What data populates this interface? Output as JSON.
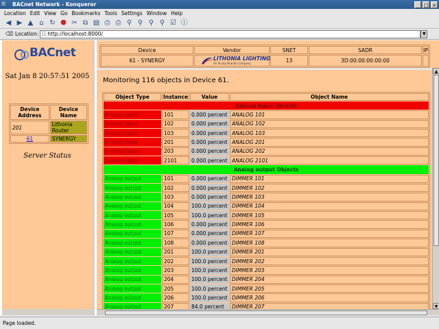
{
  "window": {
    "title": "BACnet Network - Konqueror"
  },
  "menubar": {
    "items": [
      "Location",
      "Edit",
      "View",
      "Go",
      "Bookmarks",
      "Tools",
      "Settings",
      "Window",
      "Help"
    ]
  },
  "toolbar": {
    "icons": [
      "back-icon",
      "forward-icon",
      "up-icon",
      "home-icon",
      "reload-icon",
      "stop-icon",
      "cut-icon",
      "copy-icon",
      "paste-icon",
      "print-icon",
      "print-frame-icon",
      "zoom-in-icon",
      "zoom-out-icon",
      "zoom-in-2-icon",
      "zoom-out-2-icon",
      "lock-icon",
      "info-icon"
    ]
  },
  "location": {
    "label": "Location:",
    "url": "http://localhost:8000/"
  },
  "left": {
    "logo_text": "BACnet",
    "datetime": "Sat Jan 8 20:57:51 2005",
    "device_table": {
      "headers": [
        "Device Address",
        "Device Name"
      ],
      "rows": [
        {
          "address": "201",
          "name": "Lithonia Router"
        },
        {
          "address": "61",
          "name": "SYNERGY"
        }
      ]
    },
    "server_status": "Server Status"
  },
  "header_table": {
    "headers": [
      "Device",
      "Vendor",
      "SNET",
      "SADR",
      "IP"
    ],
    "row": {
      "device": "61 - SYNERGY",
      "vendor_logo": "LITHONIA LIGHTING",
      "vendor_sub": "An Acuity Brands Company",
      "snet": "13",
      "sadr": "3D:00:00:00:00:00",
      "ip": ""
    }
  },
  "monitoring_text": "Monitoring 116 objects in Device 61.",
  "object_table": {
    "headers": [
      "Object Type",
      "Instance",
      "Value",
      "Object Name"
    ],
    "input_group": "Analog Input Objects",
    "inputs": [
      {
        "type": "Analog Input",
        "instance": "101",
        "value": "0.000 percent",
        "name": "ANALOG 101"
      },
      {
        "type": "Analog Input",
        "instance": "102",
        "value": "0.000 percent",
        "name": "ANALOG 102"
      },
      {
        "type": "Analog Input",
        "instance": "103",
        "value": "0.000 percent",
        "name": "ANALOG 103"
      },
      {
        "type": "Analog Input",
        "instance": "201",
        "value": "0.000 percent",
        "name": "ANALOG 201"
      },
      {
        "type": "Analog Input",
        "instance": "203",
        "value": "0.000 percent",
        "name": "ANALOG 202"
      },
      {
        "type": "Analog Input",
        "instance": "2101",
        "value": "0.000 percent",
        "name": "ANALOG 2101"
      }
    ],
    "output_group": "Analog output Objects",
    "outputs": [
      {
        "type": "Analog output",
        "instance": "101",
        "value": "0.000 percent",
        "name": "DIMMER 101"
      },
      {
        "type": "Analog output",
        "instance": "102",
        "value": "0.000 percent",
        "name": "DIMMER 102"
      },
      {
        "type": "Analog output",
        "instance": "103",
        "value": "0.000 percent",
        "name": "DIMMER 103"
      },
      {
        "type": "Analog output",
        "instance": "104",
        "value": "100.0 percent",
        "name": "DIMMER 104"
      },
      {
        "type": "Analog output",
        "instance": "105",
        "value": "100.0 percent",
        "name": "DIMMER 105"
      },
      {
        "type": "Analog output",
        "instance": "106",
        "value": "0.000 percent",
        "name": "DIMMER 106"
      },
      {
        "type": "Analog output",
        "instance": "107",
        "value": "0.000 percent",
        "name": "DIMMER 107"
      },
      {
        "type": "Analog output",
        "instance": "108",
        "value": "0.000 percent",
        "name": "DIMMER 108"
      },
      {
        "type": "Analog output",
        "instance": "201",
        "value": "100.0 percent",
        "name": "DIMMER 201"
      },
      {
        "type": "Analog output",
        "instance": "202",
        "value": "100.0 percent",
        "name": "DIMMER 202"
      },
      {
        "type": "Analog output",
        "instance": "203",
        "value": "100.0 percent",
        "name": "DIMMER 203"
      },
      {
        "type": "Analog output",
        "instance": "204",
        "value": "100.0 percent",
        "name": "DIMMER 204"
      },
      {
        "type": "Analog output",
        "instance": "205",
        "value": "100.0 percent",
        "name": "DIMMER 205"
      },
      {
        "type": "Analog output",
        "instance": "206",
        "value": "100.0 percent",
        "name": "DIMMER 206"
      },
      {
        "type": "Analog output",
        "instance": "207",
        "value": "84.0 percent",
        "name": "DIMMER 207"
      }
    ]
  },
  "status": {
    "text": "Page loaded."
  },
  "colors": {
    "page_bg": "#ffc896",
    "input_red": "#f00000",
    "output_green": "#00f000",
    "value_gray": "#c8c8c8",
    "device_olive": "#aaa51e",
    "titlebar_blue": "#3a6ea5"
  }
}
